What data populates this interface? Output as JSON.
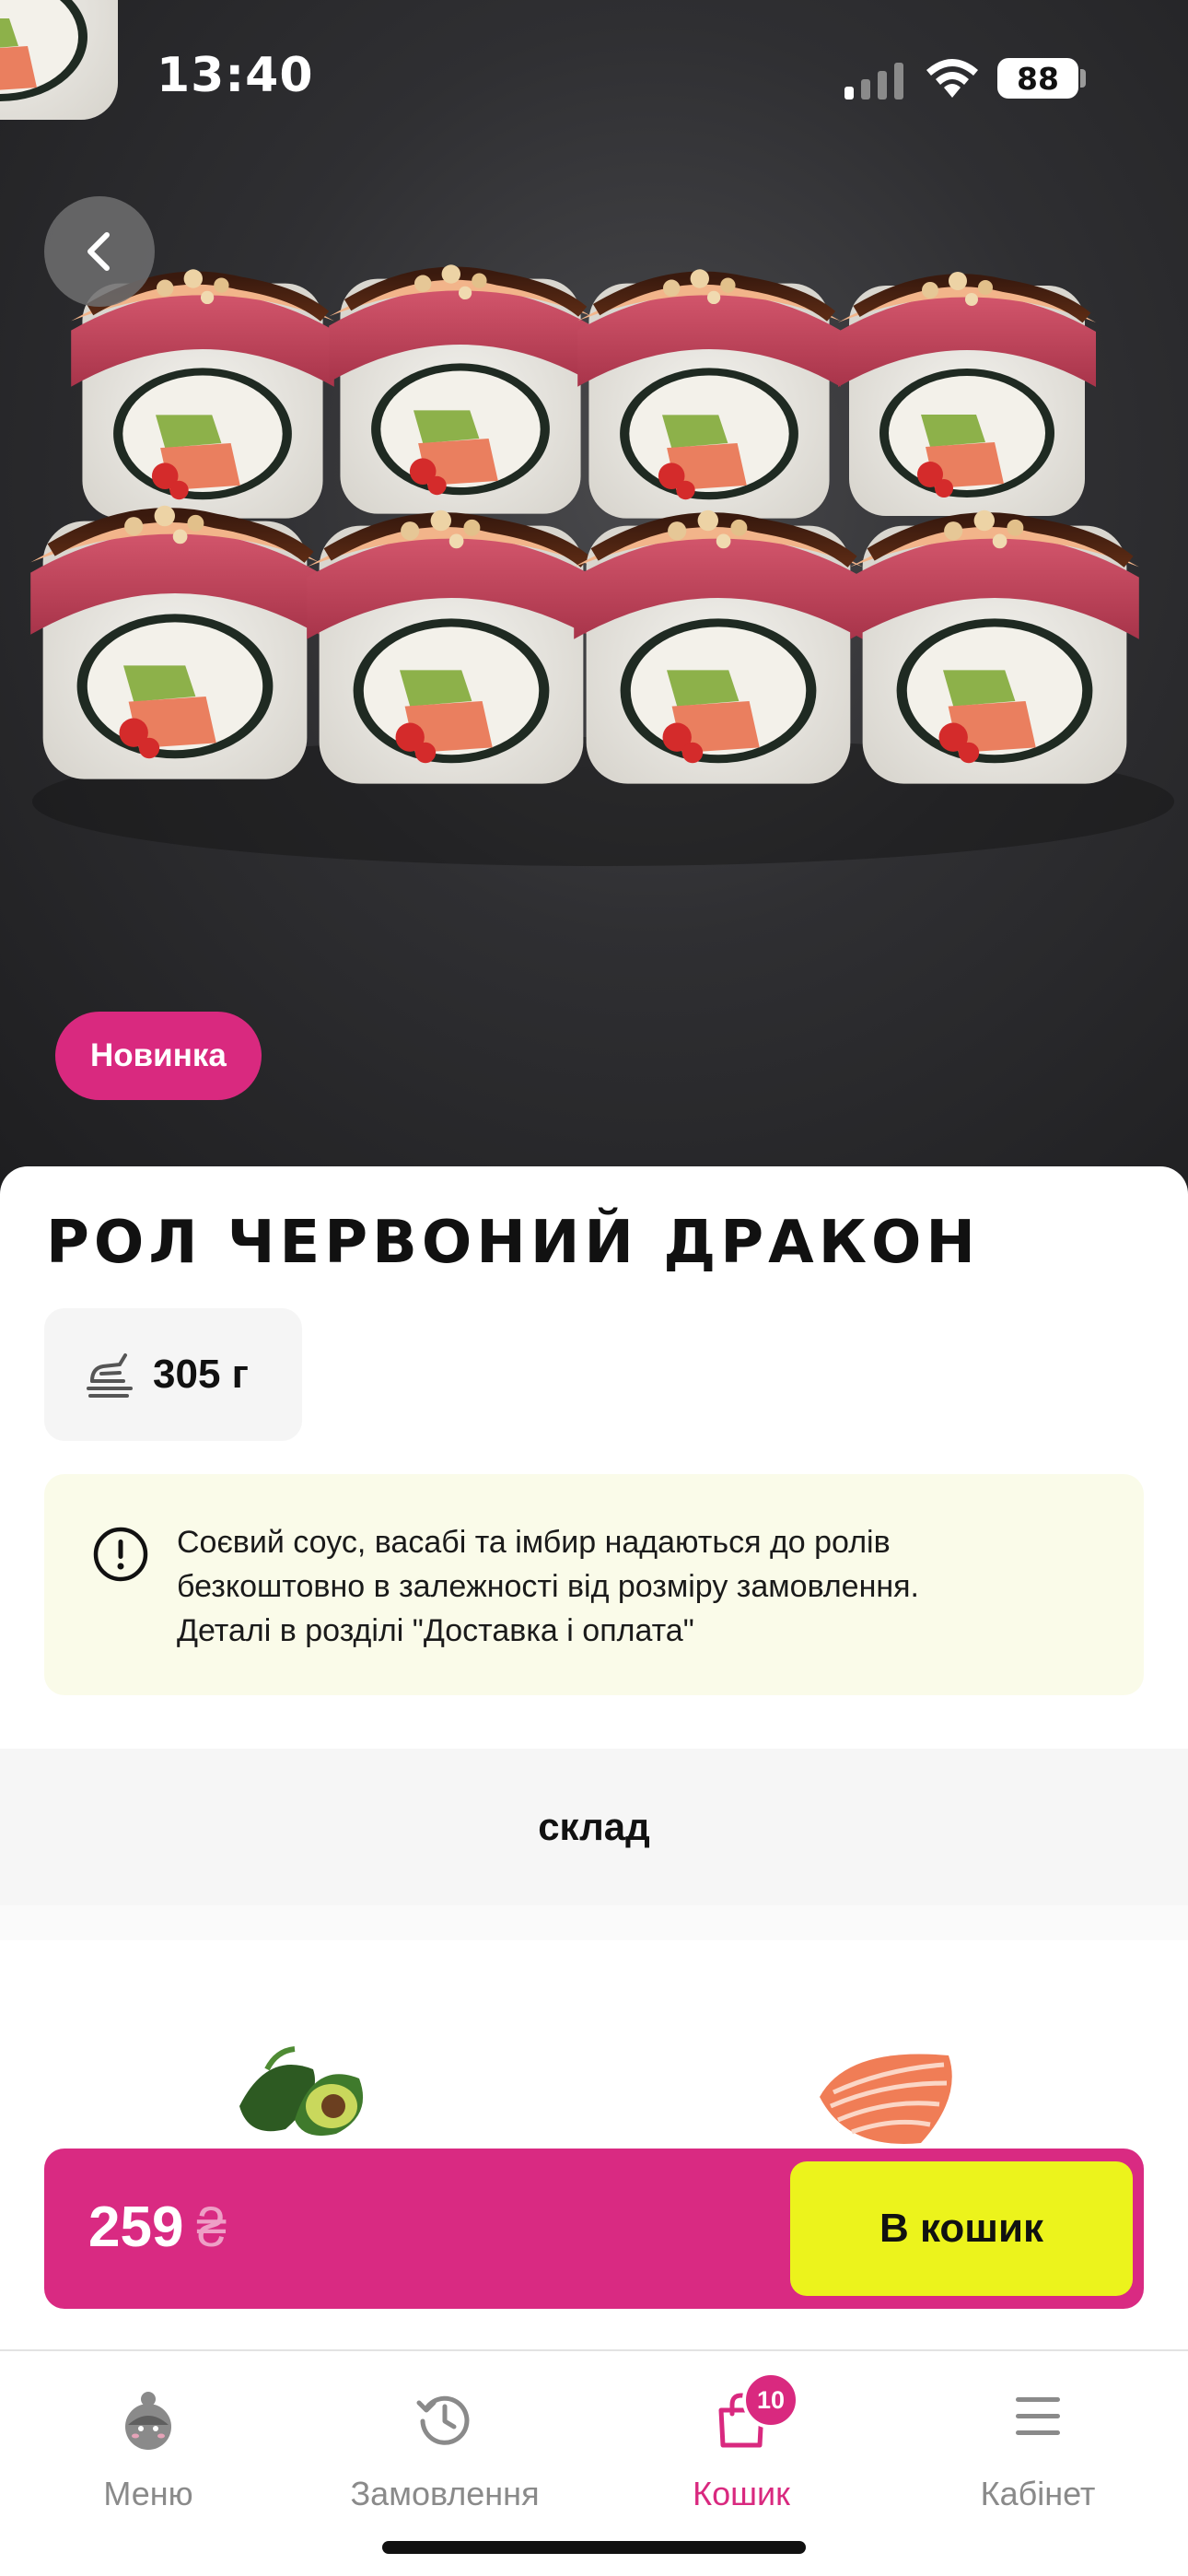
{
  "status_bar": {
    "time": "13:40",
    "battery": "88",
    "icons": [
      "signal-icon",
      "wifi-icon",
      "battery-icon"
    ]
  },
  "hero": {
    "image": "sushi-roll-photo",
    "badge": "Новинка"
  },
  "product": {
    "title": "РОЛ ЧЕРВОНИЙ ДРАКОН",
    "weight": "305 г",
    "info_line1": "Соєвий соус, васабі та імбир надаються до ролів",
    "info_line2": "безкоштовно в залежності від розміру замовлення.",
    "info_line3": "Деталі в розділі \"Доставка і оплата\""
  },
  "composition": {
    "header": "склад",
    "ingredients": [
      "avocado-image",
      "salmon-image"
    ]
  },
  "price_bar": {
    "price": "259",
    "currency": "₴",
    "add_to_cart": "В кошик"
  },
  "tab_bar": {
    "tabs": [
      {
        "label": "Меню",
        "icon": "mascot-icon"
      },
      {
        "label": "Замовлення",
        "icon": "history-icon"
      },
      {
        "label": "Кошик",
        "icon": "bag-icon",
        "badge": "10",
        "active": true
      },
      {
        "label": "Кабінет",
        "icon": "hamburger-icon"
      }
    ]
  },
  "colors": {
    "accent": "#d9297f",
    "button": "#ecf31c",
    "info_bg": "#fafbe9"
  }
}
